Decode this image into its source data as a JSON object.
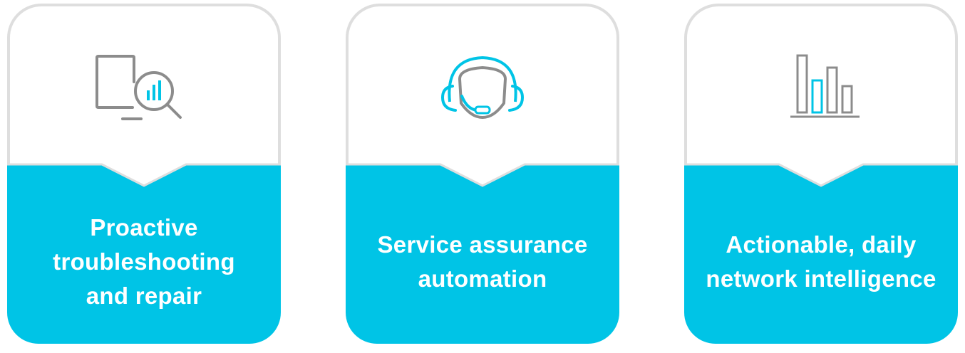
{
  "colors": {
    "accent": "#00c4e6",
    "icon_gray": "#8c8c8c",
    "border_gray": "#dedede",
    "text_on_accent": "#ffffff"
  },
  "cards": [
    {
      "icon": "monitor-magnifier-chart-icon",
      "label": "Proactive troubleshooting and repair"
    },
    {
      "icon": "headset-agent-icon",
      "label": "Service assurance automation"
    },
    {
      "icon": "bar-chart-icon",
      "label": "Actionable, daily network intelligence"
    }
  ]
}
